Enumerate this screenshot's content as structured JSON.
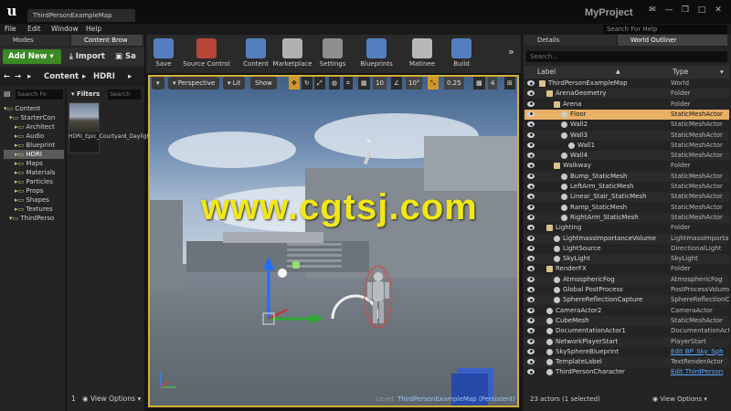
{
  "window": {
    "doc_tab": "ThirdPersonExampleMap",
    "project": "MyProject",
    "search_help_placeholder": "Search For Help"
  },
  "menu": [
    "File",
    "Edit",
    "Window",
    "Help"
  ],
  "left_panel": {
    "tabs": [
      "Modes",
      "Content Brow"
    ],
    "add_new": "Add New",
    "import": "Import",
    "save": "Sa",
    "path": [
      "Content",
      "HDRI"
    ],
    "source_search_placeholder": "Search Fo",
    "filters": "Filters",
    "asset_search_placeholder": "Search",
    "tree": [
      {
        "label": "Content",
        "level": 0
      },
      {
        "label": "StarterCon",
        "level": 1
      },
      {
        "label": "Architect",
        "level": 2
      },
      {
        "label": "Audio",
        "level": 2
      },
      {
        "label": "Blueprint",
        "level": 2
      },
      {
        "label": "HDRI",
        "level": 2
      },
      {
        "label": "Maps",
        "level": 2
      },
      {
        "label": "Materials",
        "level": 2
      },
      {
        "label": "Particles",
        "level": 2
      },
      {
        "label": "Props",
        "level": 2
      },
      {
        "label": "Shapes",
        "level": 2
      },
      {
        "label": "Textures",
        "level": 2
      },
      {
        "label": "ThirdPerso",
        "level": 1
      }
    ],
    "asset_label": "HDRI_Epic_Courtyard_Daylight",
    "item_count": "1",
    "view_options": "View Options"
  },
  "toolbar": [
    {
      "label": "Save",
      "icon": "save-icon"
    },
    {
      "label": "Source Control",
      "icon": "source-control-icon"
    },
    {
      "label": "Content",
      "icon": "content-icon"
    },
    {
      "label": "Marketplace",
      "icon": "marketplace-icon"
    },
    {
      "label": "Settings",
      "icon": "settings-icon"
    },
    {
      "label": "Blueprints",
      "icon": "blueprints-icon"
    },
    {
      "label": "Matinee",
      "icon": "matinee-icon"
    },
    {
      "label": "Build",
      "icon": "build-icon"
    }
  ],
  "viewport": {
    "perspective": "Perspective",
    "lit": "Lit",
    "show": "Show",
    "grid_snap": "10",
    "rot_snap": "10°",
    "scale_snap": "0.25",
    "cam_speed": "4",
    "level_prefix": "Level:",
    "level_name": "ThirdPersonExampleMap (Persistent)",
    "watermark": "www.cgtsj.com"
  },
  "right_panel": {
    "tabs": [
      "Details",
      "World Outliner"
    ],
    "search_placeholder": "Search...",
    "col_label": "Label",
    "col_type": "Type",
    "rows": [
      {
        "label": "ThirdPersonExampleMap",
        "type": "World",
        "indent": 0
      },
      {
        "label": "ArenaGeometry",
        "type": "Folder",
        "indent": 1
      },
      {
        "label": "Arena",
        "type": "Folder",
        "indent": 2
      },
      {
        "label": "Floor",
        "type": "StaticMeshActor",
        "indent": 3
      },
      {
        "label": "Wall2",
        "type": "StaticMeshActor",
        "indent": 3
      },
      {
        "label": "Wall3",
        "type": "StaticMeshActor",
        "indent": 3
      },
      {
        "label": "Wall1",
        "type": "StaticMeshActor",
        "indent": 4
      },
      {
        "label": "Wall4",
        "type": "StaticMeshActor",
        "indent": 3
      },
      {
        "label": "Walkway",
        "type": "Folder",
        "indent": 2
      },
      {
        "label": "Bump_StaticMesh",
        "type": "StaticMeshActor",
        "indent": 3
      },
      {
        "label": "LeftArm_StaticMesh",
        "type": "StaticMeshActor",
        "indent": 3
      },
      {
        "label": "Linear_Stair_StaticMesh",
        "type": "StaticMeshActor",
        "indent": 3
      },
      {
        "label": "Ramp_StaticMesh",
        "type": "StaticMeshActor",
        "indent": 3
      },
      {
        "label": "RightArm_StaticMesh",
        "type": "StaticMeshActor",
        "indent": 3
      },
      {
        "label": "Lighting",
        "type": "Folder",
        "indent": 1
      },
      {
        "label": "LightmassImportanceVolume",
        "type": "LightmassImporta",
        "indent": 2
      },
      {
        "label": "LightSource",
        "type": "DirectionalLight",
        "indent": 2
      },
      {
        "label": "SkyLight",
        "type": "SkyLight",
        "indent": 2
      },
      {
        "label": "RenderFX",
        "type": "Folder",
        "indent": 1
      },
      {
        "label": "AtmosphericFog",
        "type": "AtmosphericFog",
        "indent": 2
      },
      {
        "label": "Global PostProcess",
        "type": "PostProcessVolume",
        "indent": 2
      },
      {
        "label": "SphereReflectionCapture",
        "type": "SphereReflectionC",
        "indent": 2
      },
      {
        "label": "CameraActor2",
        "type": "CameraActor",
        "indent": 1
      },
      {
        "label": "CubeMesh",
        "type": "StaticMeshActor",
        "indent": 1
      },
      {
        "label": "DocumentationActor1",
        "type": "DocumentationAct",
        "indent": 1
      },
      {
        "label": "NetworkPlayerStart",
        "type": "PlayerStart",
        "indent": 1
      },
      {
        "label": "SkySphereBlueprint",
        "type": "Edit BP_Sky_Sph",
        "indent": 1,
        "link": true
      },
      {
        "label": "TemplateLabel",
        "type": "TextRenderActor",
        "indent": 1
      },
      {
        "label": "ThirdPersonCharacter",
        "type": "Edit ThirdPerson",
        "indent": 1,
        "link": true
      }
    ],
    "selected_row": 3,
    "footer": "23 actors (1 selected)",
    "view_options": "View Options"
  },
  "colors": {
    "accent_selection": "#e8b167",
    "add_new_green": "#3c8a24",
    "viewport_border": "#d4af37",
    "link_blue": "#5ea6ff",
    "watermark_yellow": "#f1e716"
  }
}
